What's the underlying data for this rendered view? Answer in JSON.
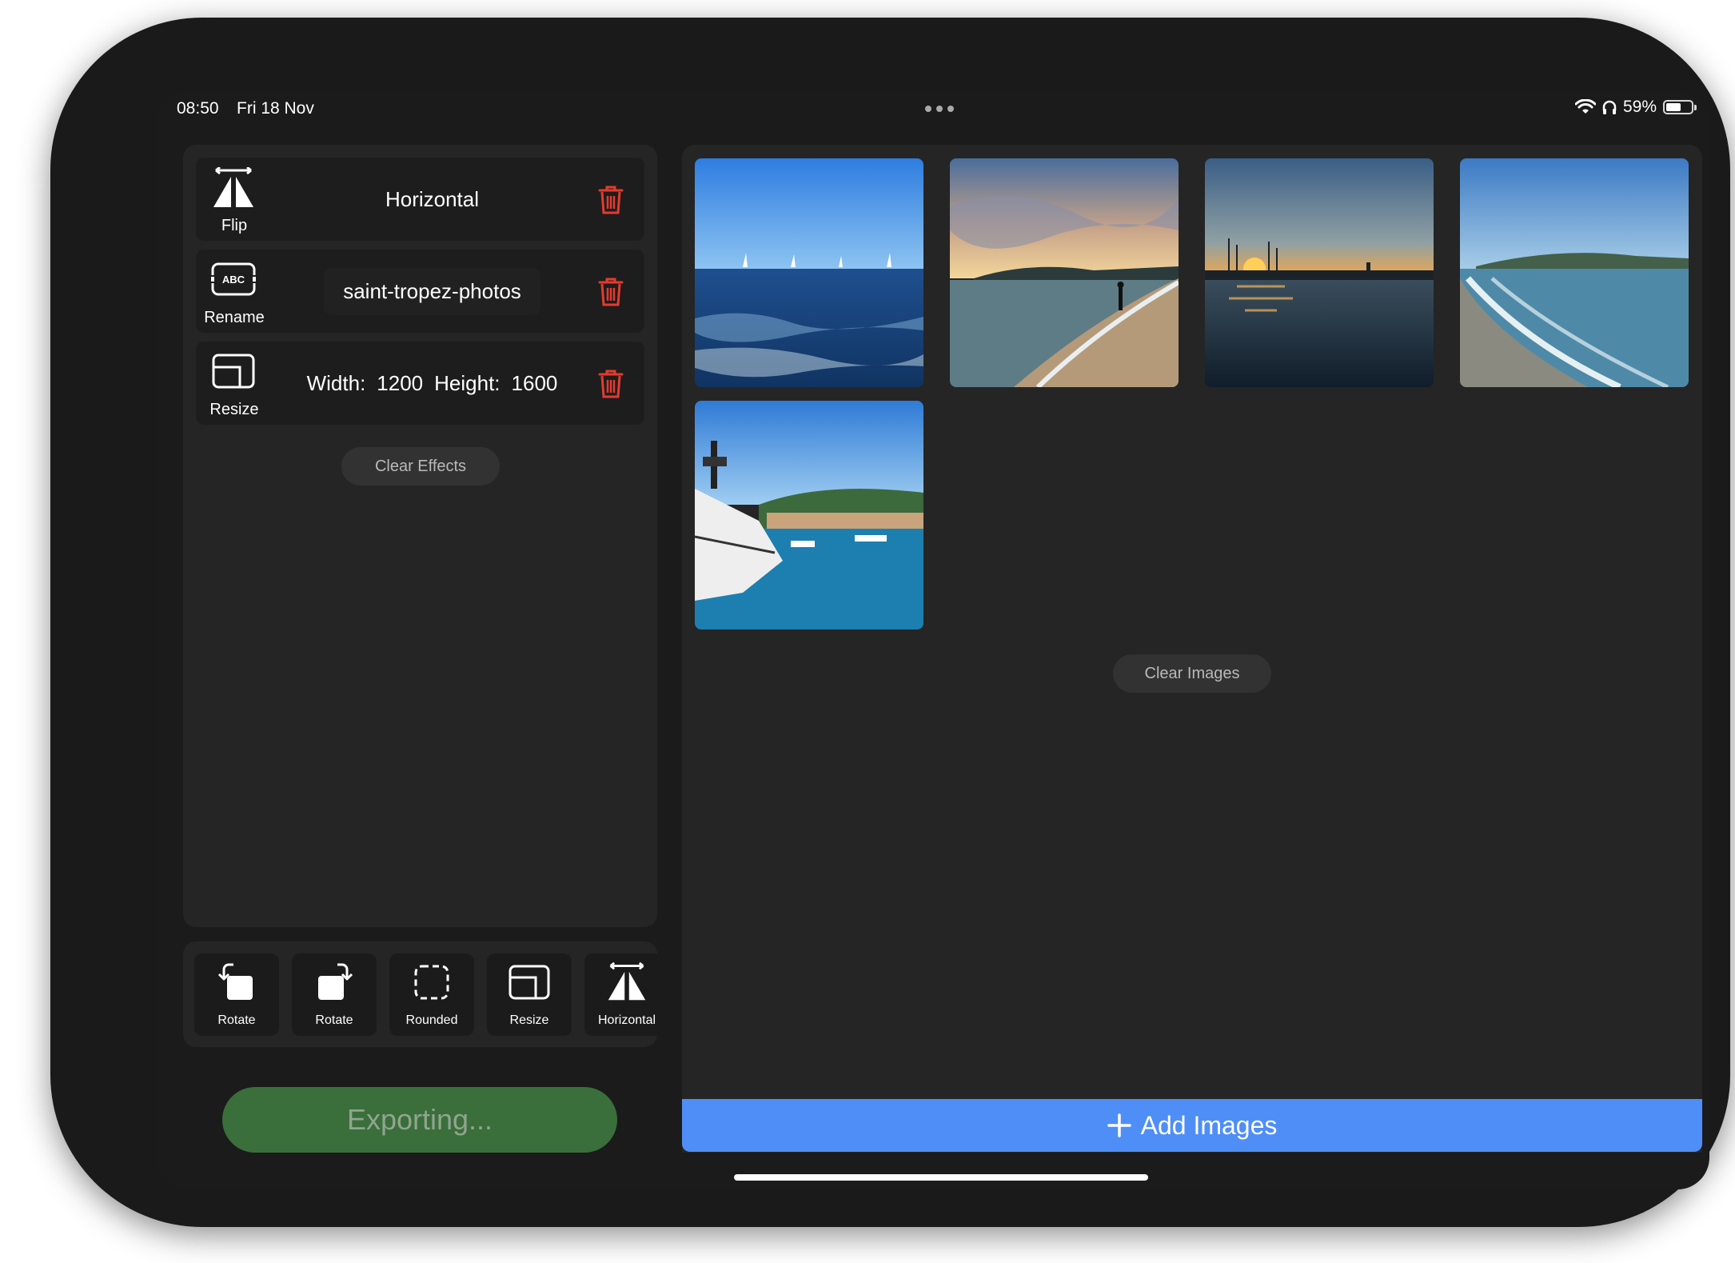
{
  "status_bar": {
    "time": "08:50",
    "date": "Fri 18 Nov",
    "battery": "59%",
    "battery_level": 0.59
  },
  "effects": {
    "flip": {
      "label": "Flip",
      "value": "Horizontal",
      "icon": "flip-icon"
    },
    "rename": {
      "label": "Rename",
      "value": "saint-tropez-photos",
      "icon": "rename-icon",
      "badge": "ABC"
    },
    "resize": {
      "label": "Resize",
      "width_label": "Width:",
      "width_value": "1200",
      "height_label": "Height:",
      "height_value": "1600",
      "icon": "resize-icon"
    },
    "clear_label": "Clear Effects"
  },
  "toolbar": {
    "items": [
      {
        "label": "Rotate",
        "icon": "rotate-left-icon"
      },
      {
        "label": "Rotate",
        "icon": "rotate-right-icon"
      },
      {
        "label": "Rounded",
        "icon": "rounded-corners-icon"
      },
      {
        "label": "Resize",
        "icon": "resize-icon"
      },
      {
        "label": "Horizontal",
        "icon": "flip-icon"
      }
    ]
  },
  "export_label": "Exporting...",
  "images": {
    "clear_label": "Clear Images",
    "add_label": "Add Images",
    "thumbnails": [
      "sea-sailboats",
      "beach-sunset-person",
      "harbor-sunset",
      "beach-waves",
      "yacht-harbor"
    ]
  },
  "colors": {
    "accent_blue": "#4f8ef6",
    "export_green": "#3a6e3a",
    "trash_red": "#e53a2f"
  }
}
